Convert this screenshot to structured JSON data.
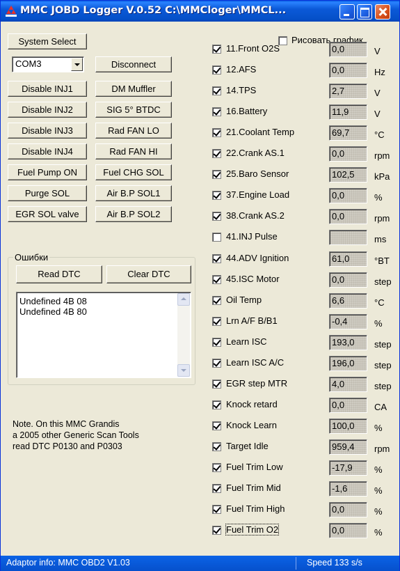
{
  "window": {
    "title": "MMC JOBD Logger V.0.52  C:\\MMCloger\\MMCL..."
  },
  "left_panel": {
    "system_select_label": "System Select",
    "com_port_value": "COM3",
    "disconnect_label": "Disconnect",
    "buttons": [
      {
        "left": "Disable INJ1",
        "right": "DM Muffler"
      },
      {
        "left": "Disable INJ2",
        "right": "SIG 5° BTDC"
      },
      {
        "left": "Disable INJ3",
        "right": "Rad FAN LO"
      },
      {
        "left": "Disable INJ4",
        "right": "Rad FAN HI"
      },
      {
        "left": "Fuel Pump ON",
        "right": "Fuel CHG SOL"
      },
      {
        "left": "Purge SOL",
        "right": "Air B.P SOL1"
      },
      {
        "left": "EGR SOL valve",
        "right": "Air B.P SOL2"
      }
    ],
    "errors": {
      "legend": "Ошибки",
      "read_label": "Read DTC",
      "clear_label": "Clear DTC",
      "items": [
        "Undefined 4B 08",
        "Undefined 4B 80"
      ]
    },
    "note": [
      "Note. On this MMC Grandis",
      "a 2005 other Generic Scan Tools",
      "read DTC P0130 and P0303"
    ]
  },
  "right_panel": {
    "draw_chart": {
      "label": "Рисовать график",
      "checked": false
    },
    "sensors": [
      {
        "label": "11.Front O2S",
        "value": "0,0",
        "unit": "V",
        "checked": true
      },
      {
        "label": "12.AFS",
        "value": "0,0",
        "unit": "Hz",
        "checked": true
      },
      {
        "label": "14.TPS",
        "value": "2,7",
        "unit": "V",
        "checked": true
      },
      {
        "label": "16.Battery",
        "value": "11,9",
        "unit": "V",
        "checked": true
      },
      {
        "label": "21.Coolant Temp",
        "value": "69,7",
        "unit": "°C",
        "checked": true
      },
      {
        "label": "22.Crank AS.1",
        "value": "0,0",
        "unit": "rpm",
        "checked": true
      },
      {
        "label": "25.Baro Sensor",
        "value": "102,5",
        "unit": "kPa",
        "checked": true
      },
      {
        "label": "37.Engine Load",
        "value": "0,0",
        "unit": "%",
        "checked": true
      },
      {
        "label": "38.Crank AS.2",
        "value": "0,0",
        "unit": "rpm",
        "checked": true
      },
      {
        "label": "41.INJ Pulse",
        "value": "",
        "unit": "ms",
        "checked": false
      },
      {
        "label": "44.ADV Ignition",
        "value": "61,0",
        "unit": "°BT",
        "checked": true
      },
      {
        "label": "45.ISC Motor",
        "value": "0,0",
        "unit": "step",
        "checked": true
      },
      {
        "label": "Oil Temp",
        "value": "6,6",
        "unit": "°C",
        "checked": true
      },
      {
        "label": "Lrn A/F B/B1",
        "value": "-0,4",
        "unit": "%",
        "checked": true
      },
      {
        "label": "Learn ISC",
        "value": "193,0",
        "unit": "step",
        "checked": true
      },
      {
        "label": "Learn ISC A/C",
        "value": "196,0",
        "unit": "step",
        "checked": true
      },
      {
        "label": "EGR step MTR",
        "value": "4,0",
        "unit": "step",
        "checked": true
      },
      {
        "label": "Knock retard",
        "value": "0,0",
        "unit": "CA",
        "checked": true
      },
      {
        "label": "Knock Learn",
        "value": "100,0",
        "unit": "%",
        "checked": true
      },
      {
        "label": "Target Idle",
        "value": "959,4",
        "unit": "rpm",
        "checked": true
      },
      {
        "label": "Fuel Trim Low",
        "value": "-17,9",
        "unit": "%",
        "checked": true
      },
      {
        "label": "Fuel Trim Mid",
        "value": "-1,6",
        "unit": "%",
        "checked": true
      },
      {
        "label": "Fuel Trim High",
        "value": "0,0",
        "unit": "%",
        "checked": true
      },
      {
        "label": "Fuel Trim O2",
        "value": "0,0",
        "unit": "%",
        "checked": true
      }
    ]
  },
  "statusbar": {
    "adaptor": "Adaptor info: MMC OBD2 V1.03",
    "speed": "Speed 133 s/s"
  }
}
